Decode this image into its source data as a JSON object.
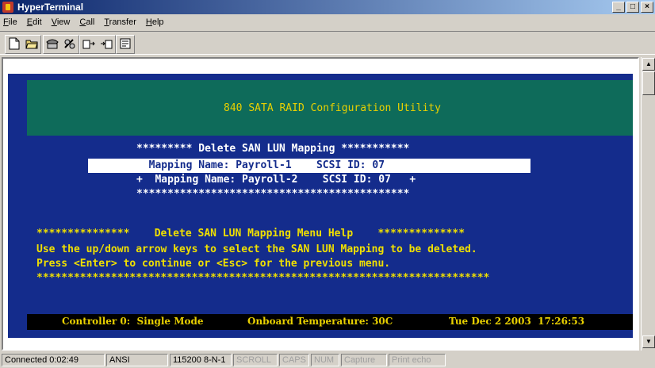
{
  "window": {
    "title": "HyperTerminal",
    "buttons": [
      "_",
      "□",
      "×"
    ]
  },
  "menu": {
    "items": [
      {
        "label": "File",
        "underline": "F",
        "rest": "ile"
      },
      {
        "label": "Edit",
        "underline": "E",
        "rest": "dit"
      },
      {
        "label": "View",
        "underline": "V",
        "rest": "iew"
      },
      {
        "label": "Call",
        "underline": "C",
        "rest": "all"
      },
      {
        "label": "Transfer",
        "underline": "T",
        "rest": "ransfer"
      },
      {
        "label": "Help",
        "underline": "H",
        "rest": "elp"
      }
    ]
  },
  "toolbar": {
    "icons": [
      "new-icon",
      "open-icon",
      "phone-icon",
      "disconnect-icon",
      "send-icon",
      "receive-icon",
      "properties-icon"
    ]
  },
  "terminal": {
    "header": "840 SATA RAID Configuration Utility",
    "menu_title": "********* Delete SAN LUN Mapping ***********",
    "row1": "  Mapping Name: Payroll-1    SCSI ID: 07  ",
    "row2": "+  Mapping Name: Payroll-2    SCSI ID: 07   +",
    "stars_line": "********************************************",
    "help_title": "***************    Delete SAN LUN Mapping Menu Help    **************",
    "help_line1": "Use the up/down arrow keys to select the SAN LUN Mapping to be deleted.",
    "help_line2": "Press <Enter> to continue or <Esc> for the previous menu.",
    "help_stars": "*************************************************************************",
    "status": {
      "controller": "Controller 0:  Single Mode",
      "temperature": "Onboard Temperature: 30C",
      "datetime": "Tue Dec 2 2003  17:26:53"
    }
  },
  "statusbar": {
    "connected": "Connected 0:02:49",
    "emulation": "ANSI",
    "settings": "115200 8-N-1",
    "scroll": "SCROLL",
    "caps": "CAPS",
    "num": "NUM",
    "capture": "Capture",
    "print_echo": "Print echo"
  },
  "colors": {
    "terminal_bg": "#142c8c",
    "header_bg": "#0e6b5a",
    "accent_yellow": "#f0e000",
    "titlebar": "#0a246a"
  }
}
